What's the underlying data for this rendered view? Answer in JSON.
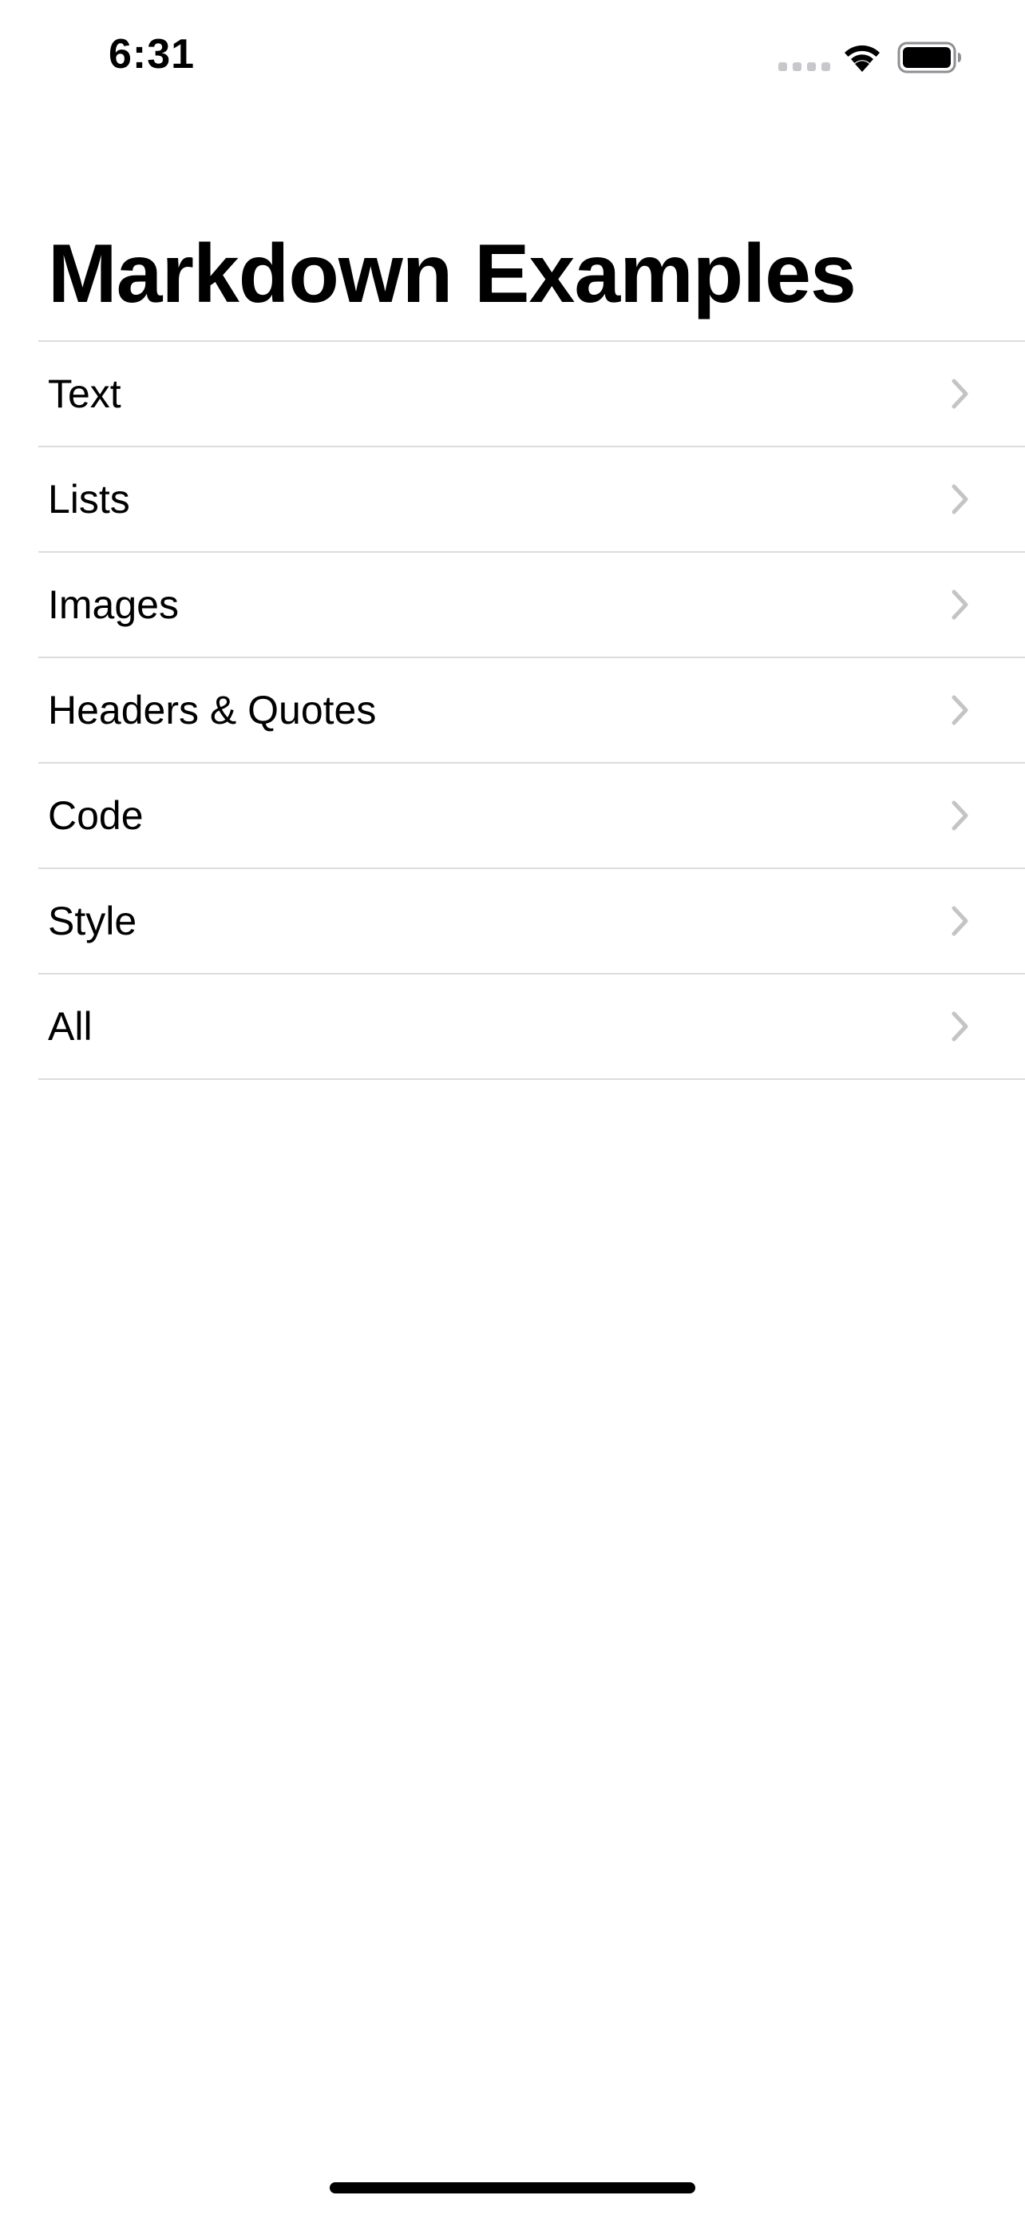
{
  "status_bar": {
    "time": "6:31"
  },
  "title": "Markdown Examples",
  "list": {
    "items": [
      {
        "label": "Text"
      },
      {
        "label": "Lists"
      },
      {
        "label": "Images"
      },
      {
        "label": "Headers & Quotes"
      },
      {
        "label": "Code"
      },
      {
        "label": "Style"
      },
      {
        "label": "All"
      }
    ],
    "chevron_icon": "chevron-right-icon",
    "chevron_color": "#c4c4c7",
    "separator_color": "#dcdce0"
  }
}
